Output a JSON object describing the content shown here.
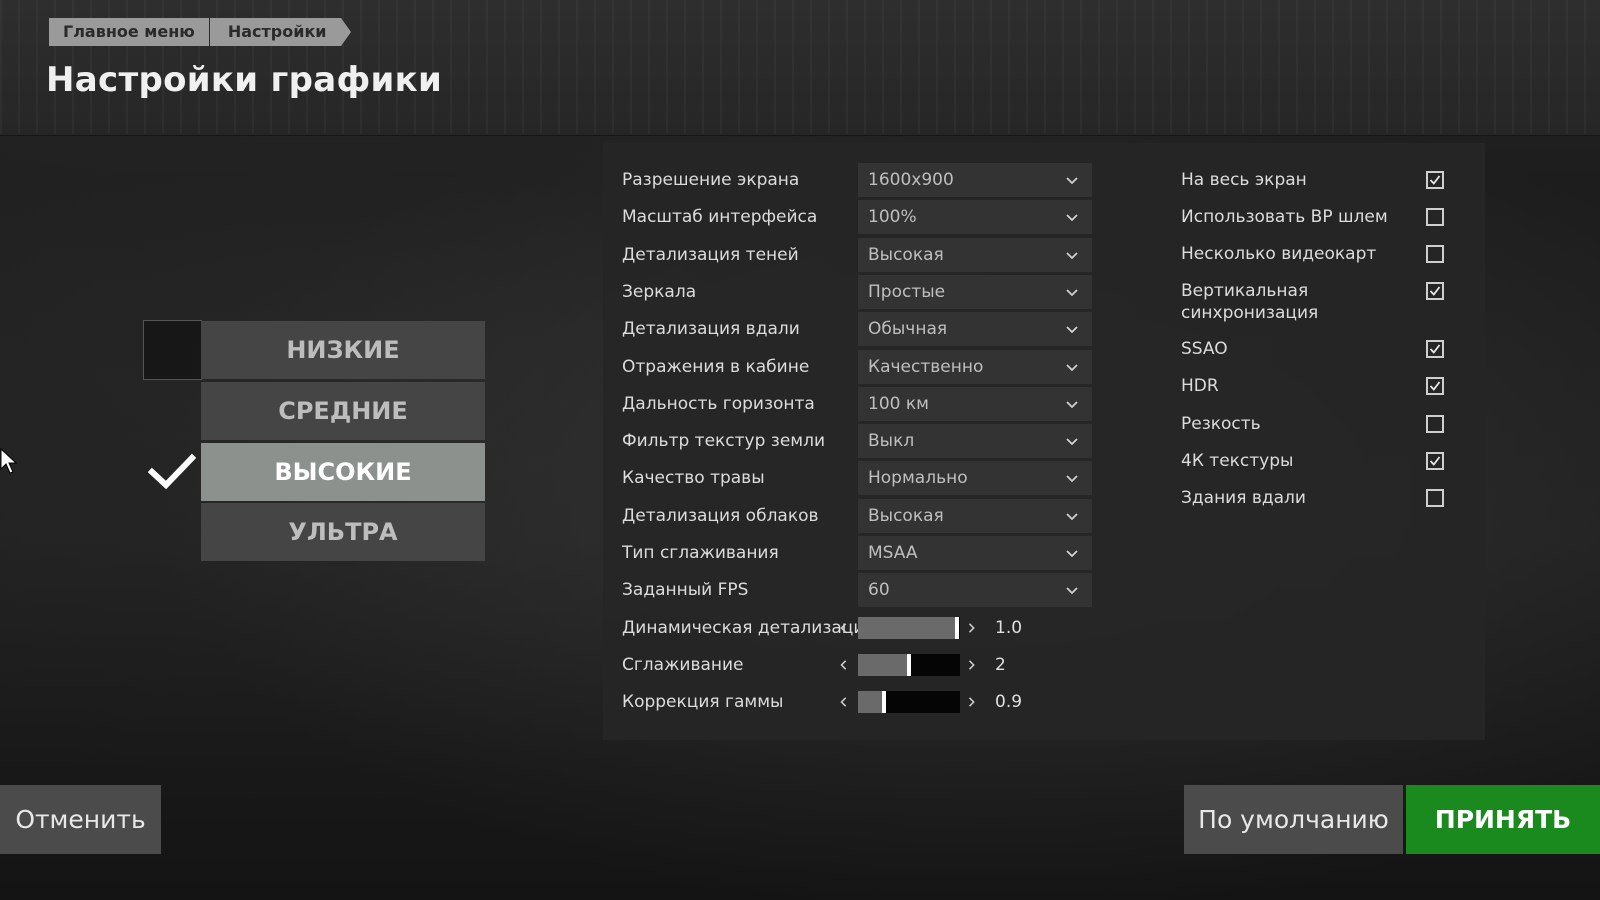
{
  "breadcrumb": [
    "Главное меню",
    "Настройки"
  ],
  "title": "Настройки графики",
  "presets": [
    {
      "label": "НИЗКИЕ",
      "selected": false
    },
    {
      "label": "СРЕДНИЕ",
      "selected": false
    },
    {
      "label": "ВЫСОКИЕ",
      "selected": true
    },
    {
      "label": "УЛЬТРА",
      "selected": false
    }
  ],
  "selects": [
    {
      "label": "Разрешение экрана",
      "value": "1600x900"
    },
    {
      "label": "Масштаб интерфейса",
      "value": "100%"
    },
    {
      "label": "Детализация теней",
      "value": "Высокая"
    },
    {
      "label": "Зеркала",
      "value": "Простые"
    },
    {
      "label": "Детализация вдали",
      "value": "Обычная"
    },
    {
      "label": "Отражения в кабине",
      "value": "Качественно"
    },
    {
      "label": "Дальность горизонта",
      "value": "100 км"
    },
    {
      "label": "Фильтр текстур земли",
      "value": "Выкл"
    },
    {
      "label": "Качество травы",
      "value": "Нормально"
    },
    {
      "label": "Детализация облаков",
      "value": "Высокая"
    },
    {
      "label": "Тип сглаживания",
      "value": "MSAA"
    },
    {
      "label": "Заданный FPS",
      "value": "60"
    }
  ],
  "sliders": [
    {
      "label": "Динамическая детализация",
      "value": "1.0",
      "fraction": 0.97
    },
    {
      "label": "Сглаживание",
      "value": "2",
      "fraction": 0.5
    },
    {
      "label": "Коррекция гаммы",
      "value": "0.9",
      "fraction": 0.25
    }
  ],
  "checkboxes": [
    {
      "label": "На весь экран",
      "checked": true
    },
    {
      "label": "Использовать ВР шлем",
      "checked": false
    },
    {
      "label": "Несколько видеокарт",
      "checked": false
    },
    {
      "label": "Вертикальная синхронизация",
      "checked": true
    },
    {
      "label": "SSAO",
      "checked": true
    },
    {
      "label": "HDR",
      "checked": true
    },
    {
      "label": "Резкость",
      "checked": false
    },
    {
      "label": "4К текстуры",
      "checked": true
    },
    {
      "label": "Здания вдали",
      "checked": false
    }
  ],
  "buttons": {
    "cancel": "Отменить",
    "default": "По умолчанию",
    "accept": "ПРИНЯТЬ"
  },
  "icons": {
    "select_arrow": "chevron-down-icon",
    "slider_left": "chevron-left-icon",
    "slider_right": "chevron-right-icon",
    "checkmark": "checkmark-icon",
    "cursor": "mouse-cursor-icon"
  },
  "colors": {
    "accept": "#1b8a1e",
    "selected_preset": "#8d918d",
    "preset": "#454545",
    "button": "#4b4b4b"
  }
}
